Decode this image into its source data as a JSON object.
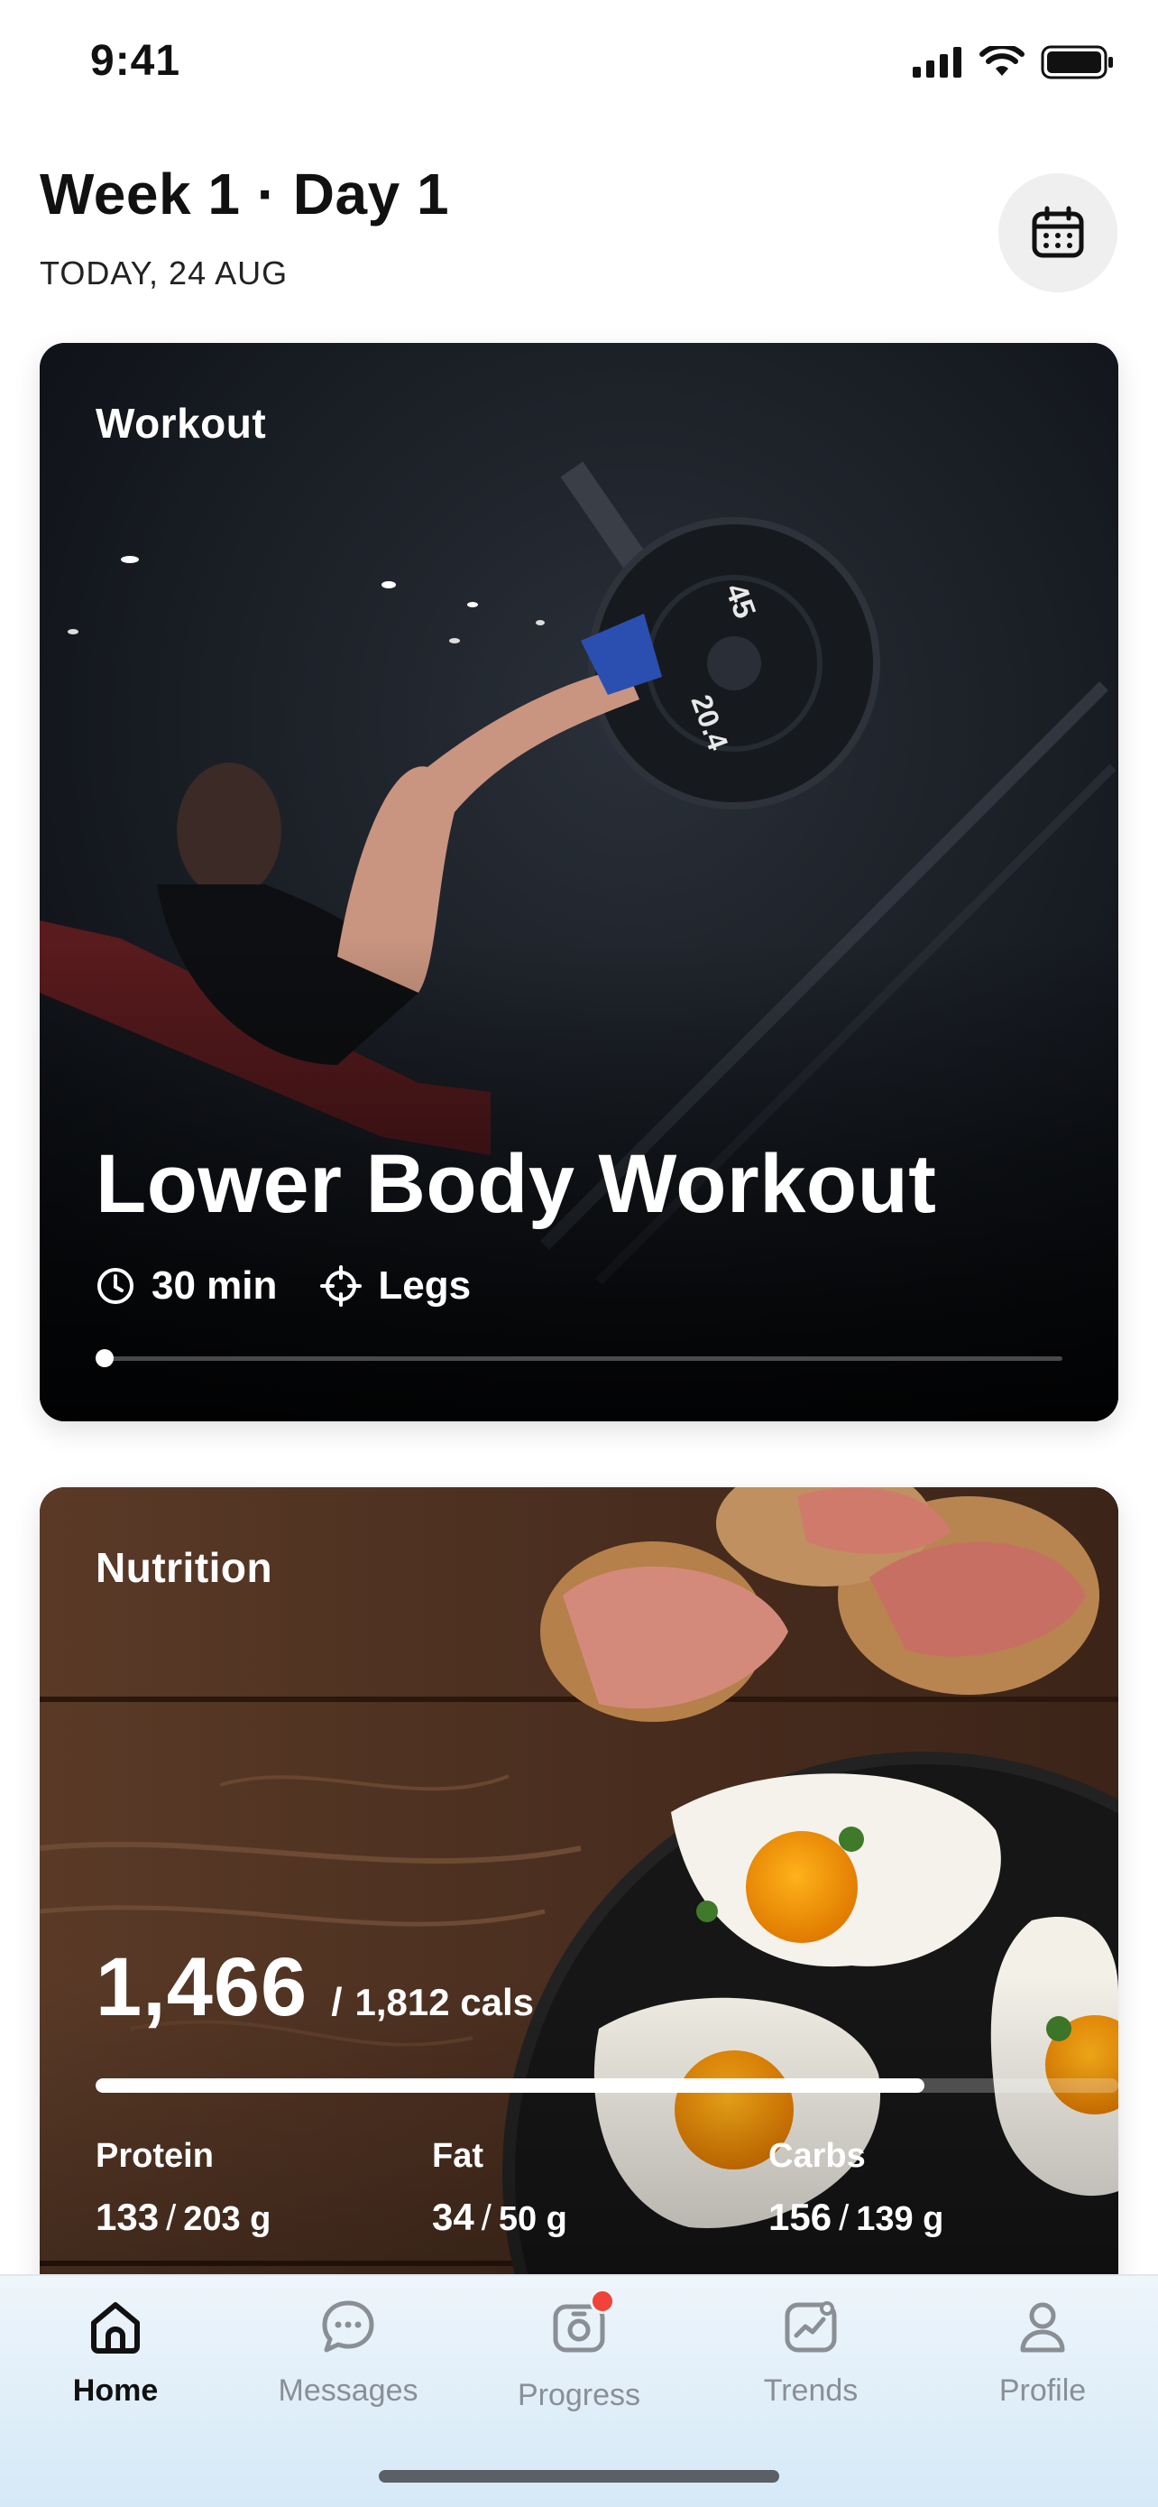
{
  "status_bar": {
    "time": "9:41"
  },
  "header": {
    "title": "Week 1 · Day 1",
    "subtitle": "TODAY, 24 AUG"
  },
  "workout_card": {
    "label": "Workout",
    "title": "Lower Body Workout",
    "duration": "30 min",
    "target": "Legs",
    "progress": 0
  },
  "nutrition_card": {
    "label": "Nutrition",
    "calories_consumed": "1,466",
    "separator": "/",
    "calories_target": "1,812 cals",
    "calories_progress": 0.81,
    "macros": [
      {
        "name": "Protein",
        "value": "133",
        "goal": "203 g"
      },
      {
        "name": "Fat",
        "value": "34",
        "goal": "50 g"
      },
      {
        "name": "Carbs",
        "value": "156",
        "goal": "139 g"
      }
    ]
  },
  "tab_bar": {
    "tabs": [
      {
        "label": "Home",
        "icon": "home-icon",
        "active": true
      },
      {
        "label": "Messages",
        "icon": "chat-icon",
        "active": false
      },
      {
        "label": "Progress",
        "icon": "camera-icon",
        "active": false,
        "badge": true
      },
      {
        "label": "Trends",
        "icon": "trend-icon",
        "active": false
      },
      {
        "label": "Profile",
        "icon": "person-icon",
        "active": false
      }
    ]
  },
  "colors": {
    "badge": "#f0443a",
    "tab_active": "#111111",
    "tab_inactive": "#8a8f96"
  }
}
